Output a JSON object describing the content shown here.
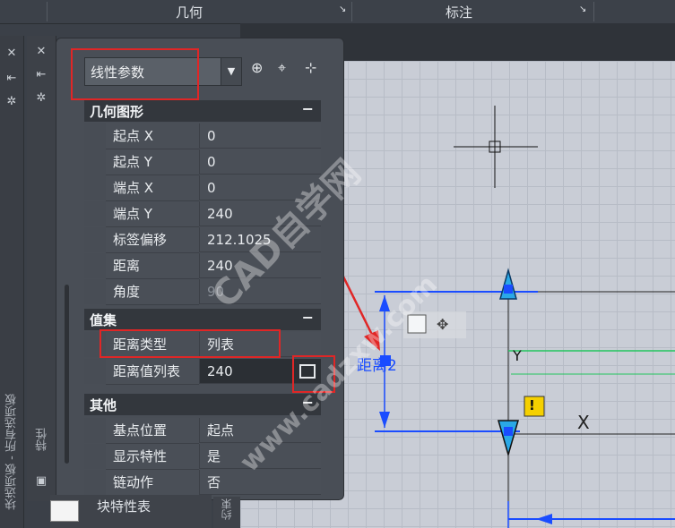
{
  "ribbon": {
    "group1": "几何",
    "group2": "标注"
  },
  "left_tabs": {
    "palette_label": "块选项板 - 所有选项板",
    "properties_label": "特性"
  },
  "panel": {
    "dropdown_value": "线性参数",
    "sections": {
      "geometry": {
        "title": "几何图形",
        "collapse": "−",
        "rows": [
          {
            "label": "起点 X",
            "value": "0"
          },
          {
            "label": "起点 Y",
            "value": "0"
          },
          {
            "label": "端点 X",
            "value": "0"
          },
          {
            "label": "端点 Y",
            "value": "240"
          },
          {
            "label": "标签偏移",
            "value": "212.1025"
          },
          {
            "label": "距离",
            "value": "240"
          },
          {
            "label": "角度",
            "value": "90"
          }
        ]
      },
      "valueset": {
        "title": "值集",
        "collapse": "−",
        "rows": [
          {
            "label": "距离类型",
            "value": "列表"
          },
          {
            "label": "距离值列表",
            "value": "240"
          }
        ]
      },
      "misc": {
        "title": "其他",
        "collapse": "−",
        "rows": [
          {
            "label": "基点位置",
            "value": "起点"
          },
          {
            "label": "显示特性",
            "value": "是"
          },
          {
            "label": "链动作",
            "value": "否"
          }
        ]
      }
    }
  },
  "bottom": {
    "block_table_label": "块特性表",
    "side_tab_label": "约束"
  },
  "canvas": {
    "distance_label": "距离2",
    "y_axis_label": "Y",
    "warning_symbol": "!",
    "x_mark": "X"
  },
  "watermark": {
    "text1": "CAD自学网",
    "text2": "www.cadzxw.com"
  },
  "colors": {
    "annotation_red": "#e02626",
    "dimension_blue": "#1a4cff",
    "grip_cyan": "#2aa8e6"
  }
}
